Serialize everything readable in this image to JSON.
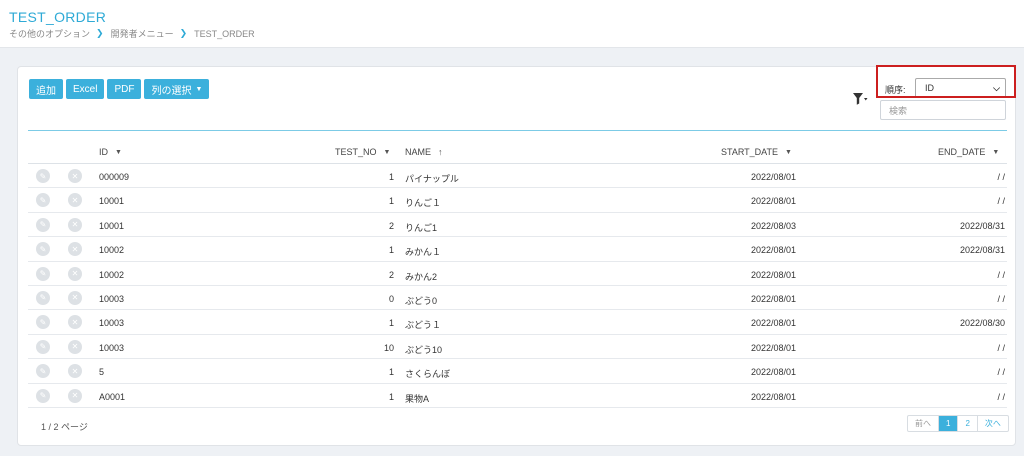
{
  "header": {
    "title": "TEST_ORDER",
    "breadcrumb": [
      "その他のオプション",
      "開発者メニュー",
      "TEST_ORDER"
    ]
  },
  "toolbar": {
    "add_label": "追加",
    "excel_label": "Excel",
    "pdf_label": "PDF",
    "columns_label": "列の選択"
  },
  "order": {
    "label": "順序:",
    "selected": "ID"
  },
  "search": {
    "placeholder": "検索"
  },
  "table": {
    "columns": [
      "ID",
      "TEST_NO",
      "NAME",
      "START_DATE",
      "END_DATE"
    ],
    "rows": [
      {
        "id": "000009",
        "test_no": "1",
        "name": "パイナップル",
        "start": "2022/08/01",
        "end": "/ /"
      },
      {
        "id": "10001",
        "test_no": "1",
        "name": "りんご１",
        "start": "2022/08/01",
        "end": "/ /"
      },
      {
        "id": "10001",
        "test_no": "2",
        "name": "りんご1",
        "start": "2022/08/03",
        "end": "2022/08/31"
      },
      {
        "id": "10002",
        "test_no": "1",
        "name": "みかん１",
        "start": "2022/08/01",
        "end": "2022/08/31"
      },
      {
        "id": "10002",
        "test_no": "2",
        "name": "みかん2",
        "start": "2022/08/01",
        "end": "/ /"
      },
      {
        "id": "10003",
        "test_no": "0",
        "name": "ぶどう0",
        "start": "2022/08/01",
        "end": "/ /"
      },
      {
        "id": "10003",
        "test_no": "1",
        "name": "ぶどう１",
        "start": "2022/08/01",
        "end": "2022/08/30"
      },
      {
        "id": "10003",
        "test_no": "10",
        "name": "ぶどう10",
        "start": "2022/08/01",
        "end": "/ /"
      },
      {
        "id": "5",
        "test_no": "1",
        "name": "さくらんぼ",
        "start": "2022/08/01",
        "end": "/ /"
      },
      {
        "id": "A0001",
        "test_no": "1",
        "name": "果物A",
        "start": "2022/08/01",
        "end": "/ /"
      }
    ]
  },
  "pagination": {
    "info": "1 / 2 ページ",
    "prev": "前へ",
    "pages": [
      "1",
      "2"
    ],
    "next": "次へ"
  },
  "colors": {
    "accent": "#3bb0dc",
    "title": "#2eaad6",
    "highlight": "#cc1f1f"
  }
}
